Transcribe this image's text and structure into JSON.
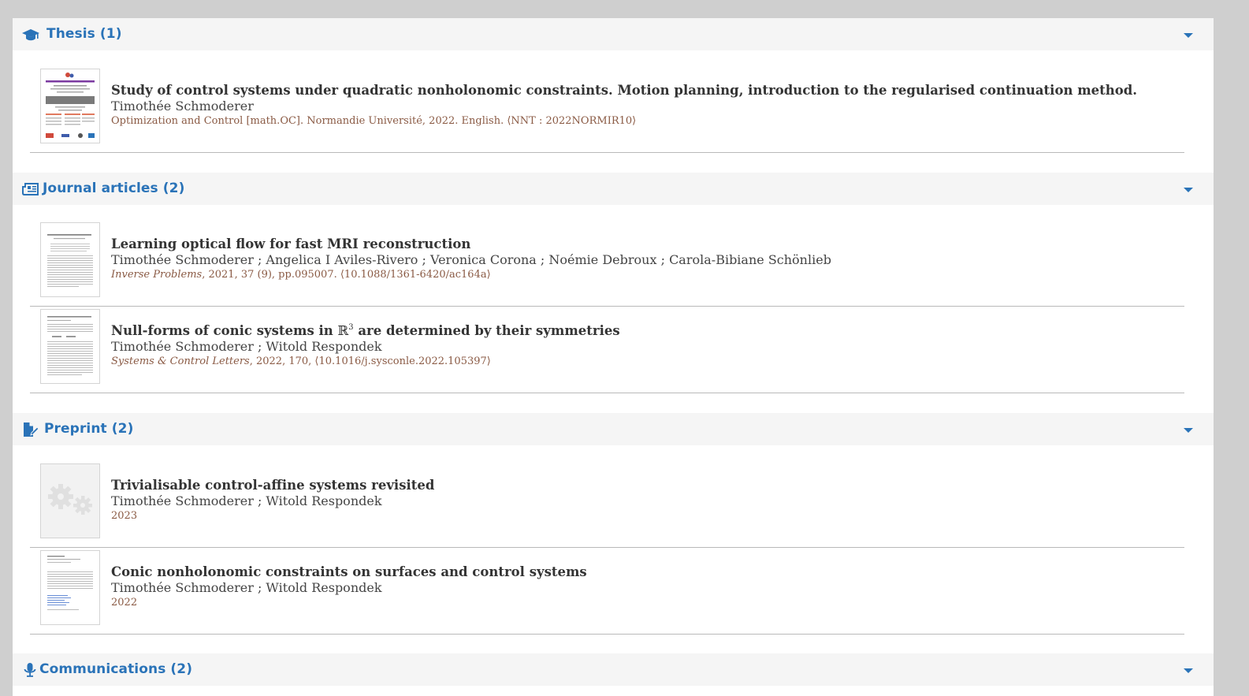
{
  "sections": [
    {
      "title": "Thesis (1)",
      "icon": "graduation-cap-icon",
      "items": [
        {
          "title": "Study of control systems under quadratic nonholonomic constraints. Motion planning, introduction to the regularised continuation method.",
          "authors": "Timothée Schmoderer",
          "meta": "Optimization and Control [math.OC]. Normandie Université, 2022. English. ⟨NNT : 2022NORMIR10⟩"
        }
      ]
    },
    {
      "title": "Journal articles (2)",
      "icon": "newspaper-icon",
      "items": [
        {
          "title": "Learning optical flow for fast MRI reconstruction",
          "authors": "Timothée Schmoderer ; Angelica I Aviles-Rivero ; Veronica Corona ; Noémie Debroux ; Carola-Bibiane Schönlieb",
          "journal": "Inverse Problems",
          "meta_rest": ", 2021, 37 (9), pp.095007. ⟨10.1088/1361-6420/ac164a⟩"
        },
        {
          "title_before": "Null-forms of conic systems in ",
          "title_symbol": "ℝ",
          "title_sup": "3",
          "title_after": " are determined by their symmetries",
          "authors": "Timothée Schmoderer ; Witold Respondek",
          "journal": "Systems & Control Letters",
          "meta_rest": ", 2022, 170, ⟨10.1016/j.sysconle.2022.105397⟩"
        }
      ]
    },
    {
      "title": "Preprint (2)",
      "icon": "file-pen-icon",
      "items": [
        {
          "title": "Trivialisable control-affine systems revisited",
          "authors": "Timothée Schmoderer ; Witold Respondek",
          "meta": "2023"
        },
        {
          "title": "Conic nonholonomic constraints on surfaces and control systems",
          "authors": "Timothée Schmoderer ; Witold Respondek",
          "meta": "2022"
        }
      ]
    },
    {
      "title": "Communications (2)",
      "icon": "microphone-icon"
    }
  ],
  "colors": {
    "accent": "#2a73b8",
    "meta": "#8a5a44",
    "header_bg": "#f5f5f5",
    "page_bg": "#cfcfcf"
  }
}
